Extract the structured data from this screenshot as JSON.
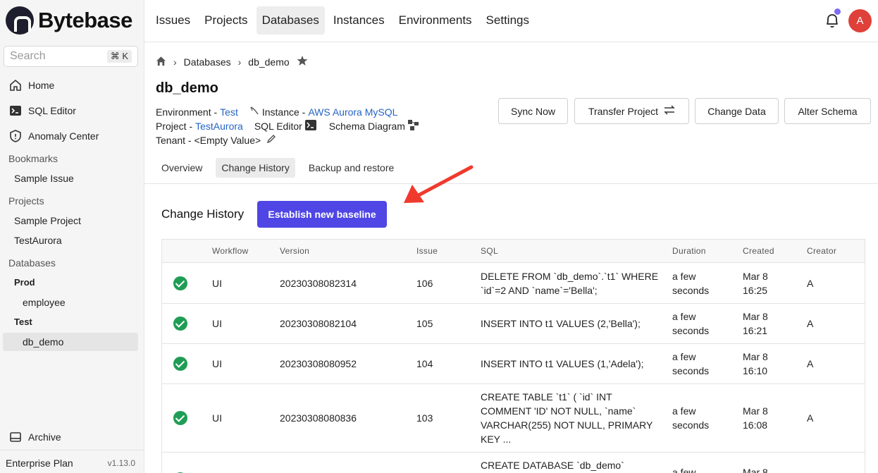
{
  "app": {
    "name": "Bytebase",
    "plan": "Enterprise Plan",
    "version": "v1.13.0"
  },
  "search": {
    "placeholder": "Search",
    "shortcut": "⌘ K"
  },
  "sidebar": {
    "nav": [
      {
        "label": "Home",
        "icon": "home-icon"
      },
      {
        "label": "SQL Editor",
        "icon": "terminal-icon"
      },
      {
        "label": "Anomaly Center",
        "icon": "shield-icon"
      }
    ],
    "bookmarks_label": "Bookmarks",
    "bookmarks": [
      "Sample Issue"
    ],
    "projects_label": "Projects",
    "projects": [
      "Sample Project",
      "TestAurora"
    ],
    "databases_label": "Databases",
    "env_prod": "Prod",
    "prod_dbs": [
      "employee"
    ],
    "env_test": "Test",
    "test_dbs": [
      "db_demo"
    ],
    "archive": "Archive"
  },
  "topnav": [
    "Issues",
    "Projects",
    "Databases",
    "Instances",
    "Environments",
    "Settings"
  ],
  "user": {
    "initial": "A"
  },
  "breadcrumb": {
    "section": "Databases",
    "current": "db_demo"
  },
  "database": {
    "name": "db_demo",
    "environment_label": "Environment - ",
    "environment": "Test",
    "instance_label": "Instance - ",
    "instance": "AWS Aurora MySQL",
    "project_label": "Project - ",
    "project": "TestAurora",
    "sql_editor": "SQL Editor",
    "schema_diagram": "Schema Diagram",
    "tenant": "Tenant - <Empty Value>"
  },
  "actions": [
    "Sync Now",
    "Transfer Project",
    "Change Data",
    "Alter Schema"
  ],
  "tabs": [
    "Overview",
    "Change History",
    "Backup and restore"
  ],
  "change_history": {
    "title": "Change History",
    "baseline_button": "Establish new baseline",
    "columns": [
      "Workflow",
      "Version",
      "Issue",
      "SQL",
      "Duration",
      "Created",
      "Creator"
    ],
    "rows": [
      {
        "workflow": "UI",
        "version": "20230308082314",
        "issue": "106",
        "sql": "DELETE FROM `db_demo`.`t1` WHERE `id`=2 AND `name`='Bella';",
        "duration": "a few seconds",
        "created": "Mar 8 16:25",
        "creator": "A"
      },
      {
        "workflow": "UI",
        "version": "20230308082104",
        "issue": "105",
        "sql": "INSERT INTO t1 VALUES (2,'Bella');",
        "duration": "a few seconds",
        "created": "Mar 8 16:21",
        "creator": "A"
      },
      {
        "workflow": "UI",
        "version": "20230308080952",
        "issue": "104",
        "sql": "INSERT INTO t1 VALUES (1,'Adela');",
        "duration": "a few seconds",
        "created": "Mar 8 16:10",
        "creator": "A"
      },
      {
        "workflow": "UI",
        "version": "20230308080836",
        "issue": "103",
        "sql": "CREATE TABLE `t1` ( `id` INT COMMENT 'ID' NOT NULL, `name` VARCHAR(255) NOT NULL, PRIMARY KEY ...",
        "duration": "a few seconds",
        "created": "Mar 8 16:08",
        "creator": "A"
      },
      {
        "workflow": "",
        "version": "",
        "issue": "",
        "sql": "CREATE DATABASE `db_demo`",
        "duration": "a few",
        "created": "Mar 8",
        "creator": ""
      }
    ]
  },
  "colors": {
    "primary": "#4f46e5",
    "link": "#2463c4",
    "success": "#1f9d55",
    "annotation_arrow": "#f03a2e",
    "avatar": "#e0403a"
  }
}
